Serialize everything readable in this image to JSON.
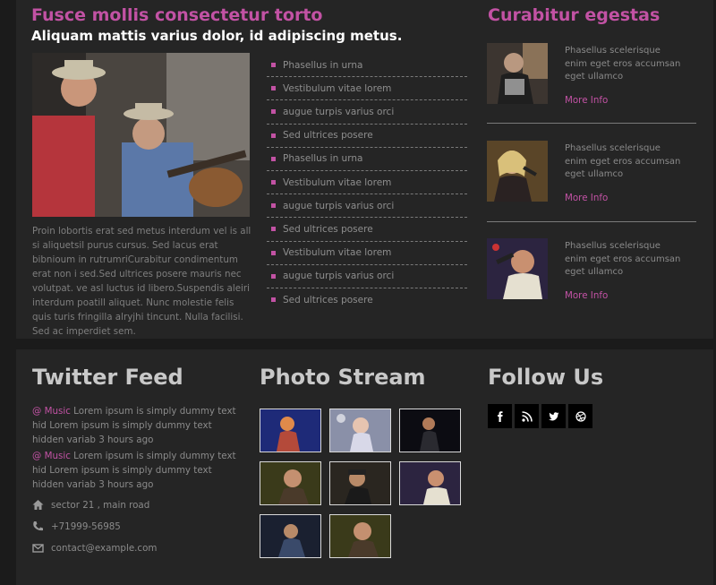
{
  "main": {
    "title": "Fusce mollis consectetur torto",
    "subtitle": "Aliquam mattis varius dolor, id adipiscing metus.",
    "body": "Proin lobortis erat sed metus interdum vel is all si aliquetsil purus cursus. Sed lacus erat bibnioum in rutrumriCurabitur condimentum erat non i sed.Sed ultrices posere mauris nec volutpat. ve asl luctus id libero.Suspendis aleiri interdum poatill aliquet. Nunc molestie felis quis turis fringilla alryjhi tincunt. Nulla facilisi. Sed ac imperdiet sem."
  },
  "list": [
    "Phasellus in urna",
    "Vestibulum vitae lorem",
    "augue turpis varius orci",
    "Sed ultrices posere",
    "Phasellus in urna",
    "Vestibulum vitae lorem",
    "augue turpis varius orci",
    "Sed ultrices posere",
    "Vestibulum vitae lorem",
    "augue turpis varius orci",
    "Sed ultrices posere"
  ],
  "side": {
    "title": "Curabitur egestas",
    "items": [
      {
        "desc": "Phasellus scelerisque enim eget eros accumsan eget ullamco",
        "more": "More Info"
      },
      {
        "desc": "Phasellus scelerisque enim eget eros accumsan eget ullamco",
        "more": "More Info"
      },
      {
        "desc": "Phasellus scelerisque enim eget eros accumsan eget ullamco",
        "more": "More Info"
      }
    ]
  },
  "twitter": {
    "title": "Twitter Feed",
    "tweets": [
      {
        "handle": "@ Music",
        "text": " Lorem ipsum is simply dummy text hid Lorem ipsum is simply dummy text hidden variab 3 hours ago"
      },
      {
        "handle": "@ Music",
        "text": " Lorem ipsum is simply dummy text hid Lorem ipsum is simply dummy text hidden variab 3 hours ago"
      }
    ],
    "address": "sector 21 , main road",
    "phone": "+71999-56985",
    "email": "contact@example.com"
  },
  "photos": {
    "title": "Photo Stream"
  },
  "follow": {
    "title": "Follow Us",
    "icons": [
      "facebook-icon",
      "rss-icon",
      "twitter-icon",
      "dribbble-icon"
    ]
  },
  "colors": {
    "accent": "#c252a4",
    "panel": "#252525",
    "background": "#1b1b1b"
  }
}
